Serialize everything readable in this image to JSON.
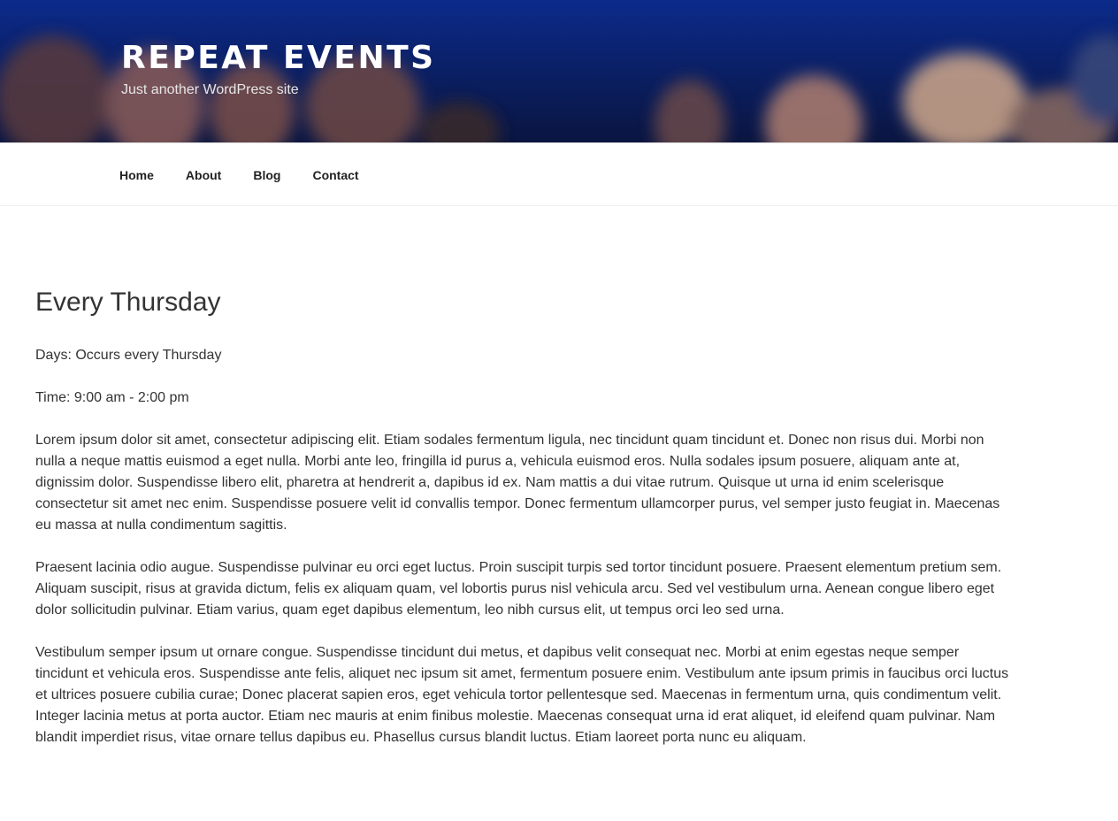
{
  "header": {
    "site_title": "Repeat Events",
    "site_description": "Just another WordPress site"
  },
  "nav": {
    "items": [
      {
        "label": "Home"
      },
      {
        "label": "About"
      },
      {
        "label": "Blog"
      },
      {
        "label": "Contact"
      }
    ]
  },
  "post": {
    "title": "Every Thursday",
    "days": "Days: Occurs every Thursday",
    "time": "Time: 9:00 am - 2:00 pm",
    "paragraphs": [
      "Lorem ipsum dolor sit amet, consectetur adipiscing elit. Etiam sodales fermentum ligula, nec tincidunt quam tincidunt et. Donec non risus dui. Morbi non nulla a neque mattis euismod a eget nulla. Morbi ante leo, fringilla id purus a, vehicula euismod eros. Nulla sodales ipsum posuere, aliquam ante at, dignissim dolor. Suspendisse libero elit, pharetra at hendrerit a, dapibus id ex. Nam mattis a dui vitae rutrum. Quisque ut urna id enim scelerisque consectetur sit amet nec enim. Suspendisse posuere velit id convallis tempor. Donec fermentum ullamcorper purus, vel semper justo feugiat in. Maecenas eu massa at nulla condimentum sagittis.",
      "Praesent lacinia odio augue. Suspendisse pulvinar eu orci eget luctus. Proin suscipit turpis sed tortor tincidunt posuere. Praesent elementum pretium sem. Aliquam suscipit, risus at gravida dictum, felis ex aliquam quam, vel lobortis purus nisl vehicula arcu. Sed vel vestibulum urna. Aenean congue libero eget dolor sollicitudin pulvinar. Etiam varius, quam eget dapibus elementum, leo nibh cursus elit, ut tempus orci leo sed urna.",
      "Vestibulum semper ipsum ut ornare congue. Suspendisse tincidunt dui metus, et dapibus velit consequat nec. Morbi at enim egestas neque semper tincidunt et vehicula eros. Suspendisse ante felis, aliquet nec ipsum sit amet, fermentum posuere enim. Vestibulum ante ipsum primis in faucibus orci luctus et ultrices posuere cubilia curae; Donec placerat sapien eros, eget vehicula tortor pellentesque sed. Maecenas in fermentum urna, quis condimentum velit. Integer lacinia metus at porta auctor. Etiam nec mauris at enim finibus molestie. Maecenas consequat urna id erat aliquet, id eleifend quam pulvinar. Nam blandit imperdiet risus, vitae ornare tellus dapibus eu. Phasellus cursus blandit luctus. Etiam laoreet porta nunc eu aliquam."
    ]
  },
  "colors": {
    "header_bg": "#0a1f5c",
    "text": "#333333",
    "nav_text": "#222222"
  }
}
